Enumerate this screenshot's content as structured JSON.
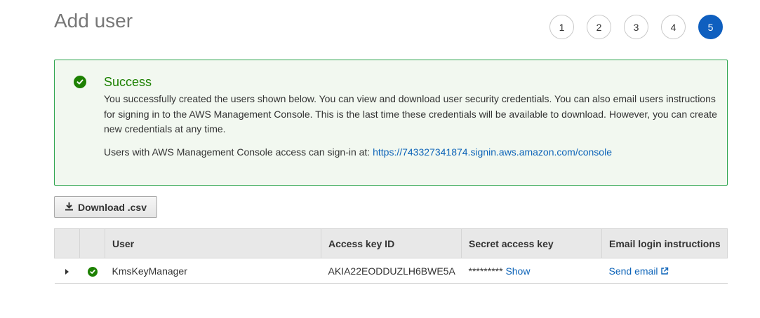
{
  "header": {
    "title": "Add user"
  },
  "steps": [
    {
      "label": "1",
      "active": false
    },
    {
      "label": "2",
      "active": false
    },
    {
      "label": "3",
      "active": false
    },
    {
      "label": "4",
      "active": false
    },
    {
      "label": "5",
      "active": true
    }
  ],
  "alert": {
    "icon": "check-circle-icon",
    "title": "Success",
    "body": "You successfully created the users shown below. You can view and download user security credentials. You can also email users instructions for signing in to the AWS Management Console. This is the last time these credentials will be available to download. However, you can create new credentials at any time.",
    "signin_prefix": "Users with AWS Management Console access can sign-in at: ",
    "signin_url": "https://743327341874.signin.aws.amazon.com/console",
    "color": "#1d8102"
  },
  "toolbar": {
    "download_label": "Download .csv",
    "download_icon": "download-icon"
  },
  "table": {
    "headers": [
      "",
      "",
      "User",
      "Access key ID",
      "Secret access key",
      "Email login instructions"
    ],
    "rows": [
      {
        "user": "KmsKeyManager",
        "access_key_id": "AKIA22EODDUZLH6BWE5A",
        "secret_masked": "*********",
        "secret_show_label": "Show",
        "email_label": "Send email",
        "email_icon": "external-link-icon"
      }
    ]
  },
  "colors": {
    "accent": "#0f5fbf",
    "link": "#0c63b8",
    "success": "#1d8102"
  }
}
